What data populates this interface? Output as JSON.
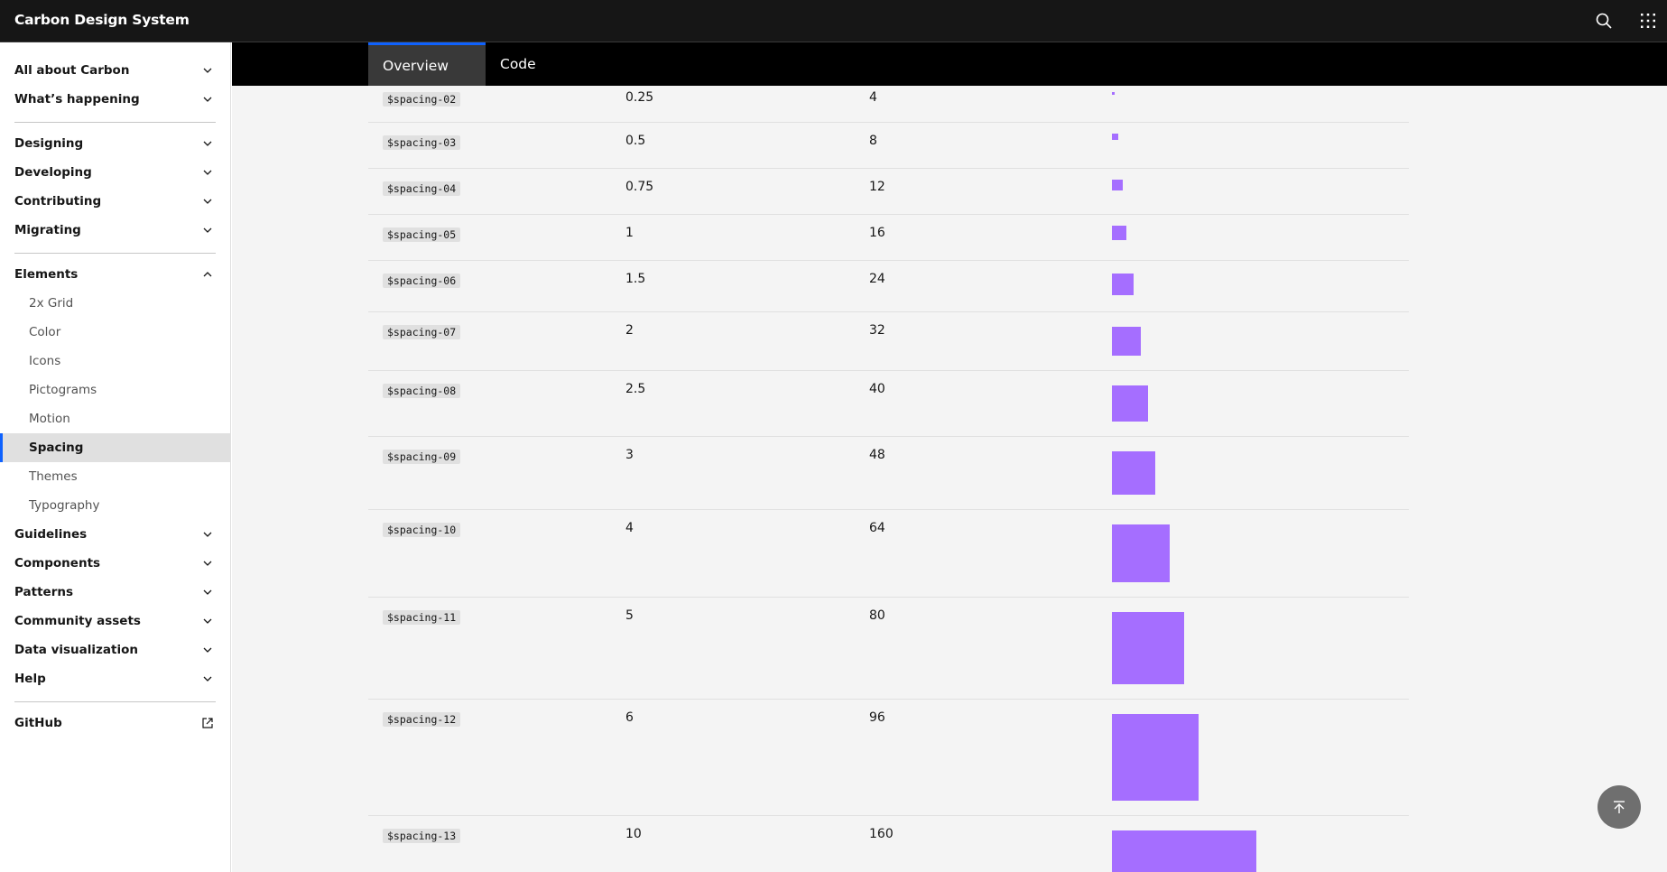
{
  "header": {
    "brand": "Carbon Design System",
    "icons": {
      "search": "search-icon",
      "switcher": "app-switcher-icon"
    }
  },
  "sidebar": {
    "items": [
      {
        "label": "All about Carbon"
      },
      {
        "label": "What’s happening"
      },
      {
        "label": "Designing"
      },
      {
        "label": "Developing"
      },
      {
        "label": "Contributing"
      },
      {
        "label": "Migrating"
      },
      {
        "label": "Elements"
      },
      {
        "label": "Guidelines"
      },
      {
        "label": "Components"
      },
      {
        "label": "Patterns"
      },
      {
        "label": "Community assets"
      },
      {
        "label": "Data visualization"
      },
      {
        "label": "Help"
      },
      {
        "label": "GitHub"
      }
    ],
    "elements_children": [
      {
        "label": "2x Grid"
      },
      {
        "label": "Color"
      },
      {
        "label": "Icons"
      },
      {
        "label": "Pictograms"
      },
      {
        "label": "Motion"
      },
      {
        "label": "Spacing",
        "active": true
      },
      {
        "label": "Themes"
      },
      {
        "label": "Typography"
      }
    ]
  },
  "tabs": [
    {
      "label": "Overview",
      "active": true
    },
    {
      "label": "Code",
      "active": false
    }
  ],
  "spacing_table": {
    "rows": [
      {
        "token": "$spacing-02",
        "rem": "0.25",
        "px": "4"
      },
      {
        "token": "$spacing-03",
        "rem": "0.5",
        "px": "8"
      },
      {
        "token": "$spacing-04",
        "rem": "0.75",
        "px": "12"
      },
      {
        "token": "$spacing-05",
        "rem": "1",
        "px": "16"
      },
      {
        "token": "$spacing-06",
        "rem": "1.5",
        "px": "24"
      },
      {
        "token": "$spacing-07",
        "rem": "2",
        "px": "32"
      },
      {
        "token": "$spacing-08",
        "rem": "2.5",
        "px": "40"
      },
      {
        "token": "$spacing-09",
        "rem": "3",
        "px": "48"
      },
      {
        "token": "$spacing-10",
        "rem": "4",
        "px": "64"
      },
      {
        "token": "$spacing-11",
        "rem": "5",
        "px": "80"
      },
      {
        "token": "$spacing-12",
        "rem": "6",
        "px": "96"
      },
      {
        "token": "$spacing-13",
        "rem": "10",
        "px": "160"
      }
    ]
  },
  "colors": {
    "header_bg": "#161616",
    "accent": "#0f62fe",
    "swatch": "#a56eff",
    "main_bg": "#f4f4f4"
  },
  "back_to_top": {
    "icon": "back-to-top-icon"
  }
}
